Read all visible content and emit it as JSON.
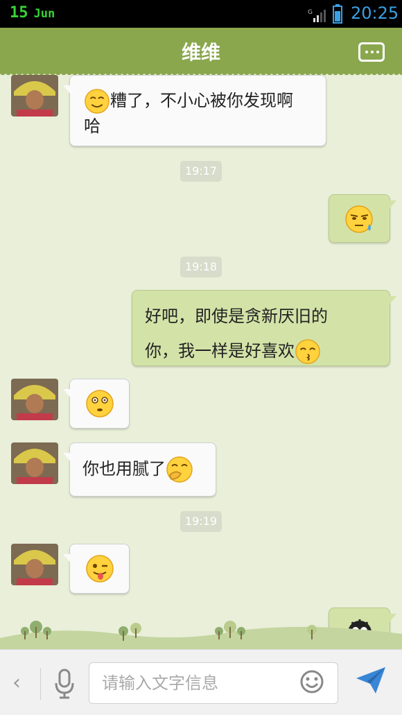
{
  "status_bar": {
    "day": "15",
    "month": "Jun",
    "time": "20:25"
  },
  "header": {
    "title": "维维",
    "menu_icon": "more-options-icon"
  },
  "messages": [
    {
      "dir": "in",
      "text_line1": "糟了，不小心被你发现啊",
      "text_line2": "哈",
      "emoji": "smile-face"
    },
    {
      "type": "time",
      "text": "19:17"
    },
    {
      "dir": "out",
      "emoji": "sweat-face"
    },
    {
      "type": "time",
      "text": "19:18"
    },
    {
      "dir": "out",
      "text_line1": "好吧，即使是贪新厌旧的",
      "text_line2": "你，我一样是好喜欢",
      "emoji": "kiss-face"
    },
    {
      "dir": "in",
      "emoji": "surprised-face"
    },
    {
      "dir": "in",
      "text": "你也用腻了",
      "emoji": "shy-face"
    },
    {
      "type": "time",
      "text": "19:19"
    },
    {
      "dir": "in",
      "emoji": "tongue-wink-face"
    },
    {
      "dir": "out",
      "emoji": "crying-monster"
    }
  ],
  "input": {
    "placeholder": "请输入文字信息"
  },
  "colors": {
    "header": "#8aa74e",
    "out_bubble": "#d3e3a8",
    "in_bubble": "#fafafa",
    "background": "#e9efd9"
  }
}
